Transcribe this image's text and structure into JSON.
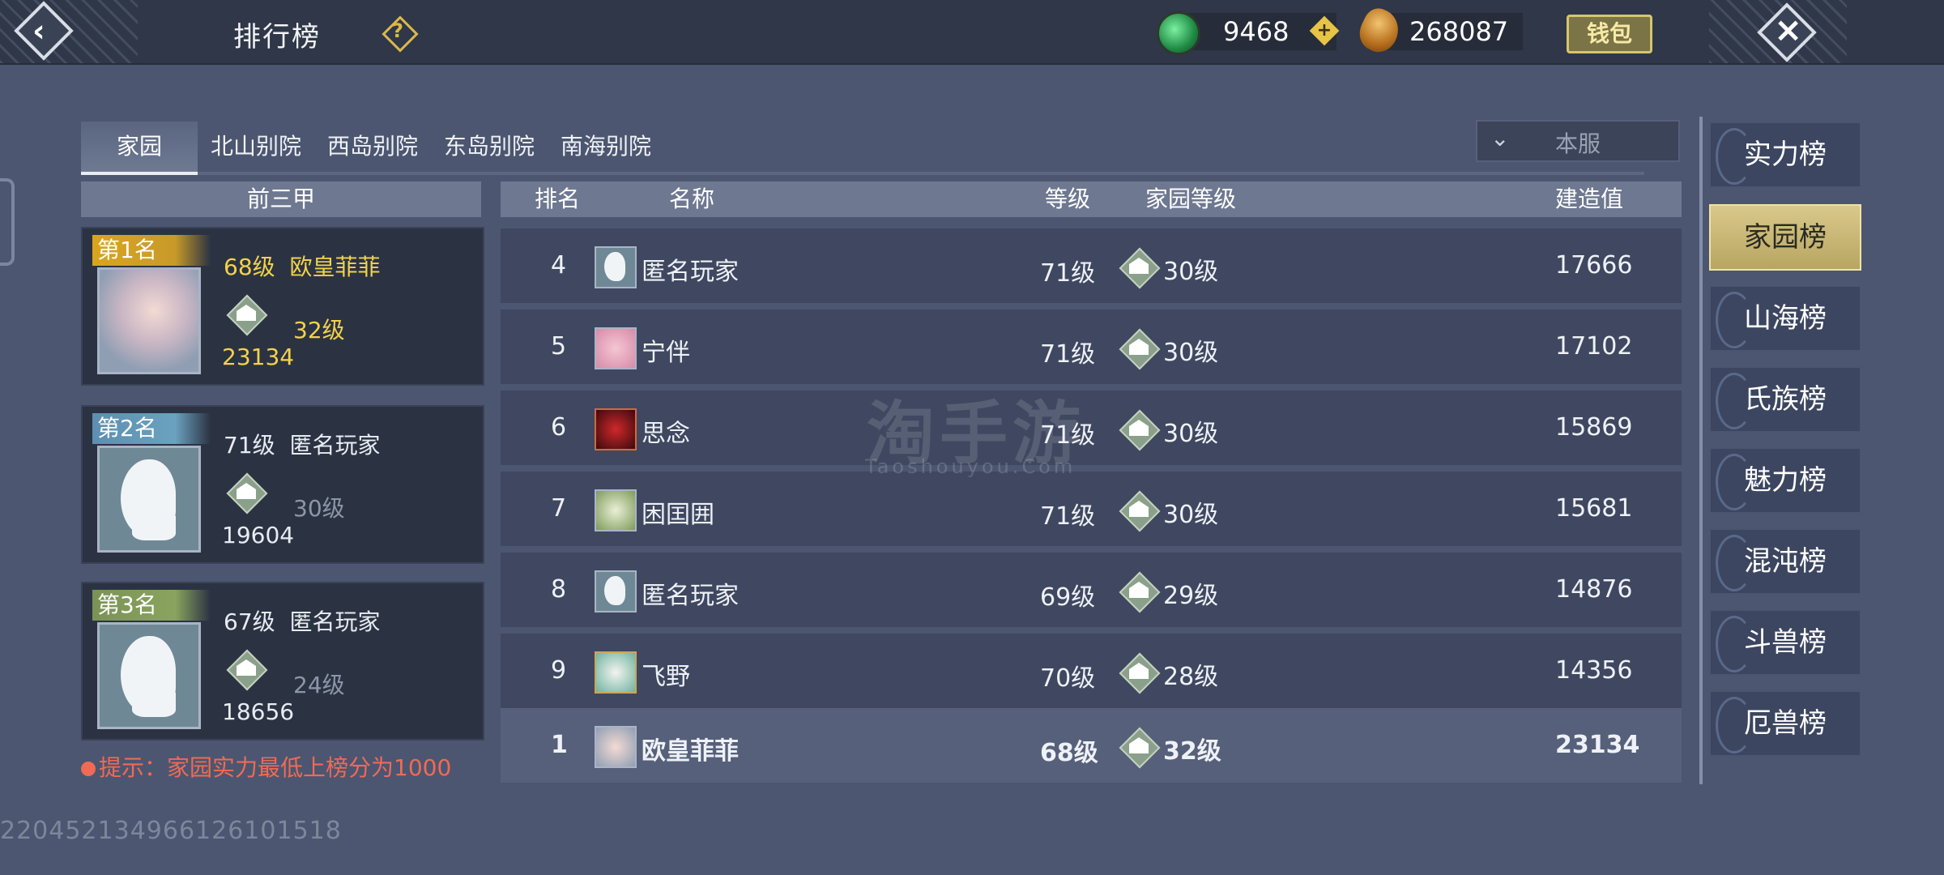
{
  "header": {
    "title": "排行榜",
    "help_icon": "question-icon",
    "jade": "9468",
    "coins": "268087",
    "wallet_label": "钱包"
  },
  "tabs": [
    {
      "label": "家园",
      "active": true
    },
    {
      "label": "北山别院",
      "active": false
    },
    {
      "label": "西岛别院",
      "active": false
    },
    {
      "label": "东岛别院",
      "active": false
    },
    {
      "label": "南海别院",
      "active": false
    }
  ],
  "server_filter": {
    "selected": "本服"
  },
  "top3": {
    "heading": "前三甲",
    "cards": [
      {
        "rank_label": "第1名",
        "level": "68级",
        "name": "欧皇菲菲",
        "home_level": "32级",
        "score": "23134"
      },
      {
        "rank_label": "第2名",
        "level": "71级",
        "name": "匿名玩家",
        "home_level": "30级",
        "score": "19604"
      },
      {
        "rank_label": "第3名",
        "level": "67级",
        "name": "匿名玩家",
        "home_level": "24级",
        "score": "18656"
      }
    ]
  },
  "tip": "提示：家园实力最低上榜分为1000",
  "user_id": "22045213496612610151​8",
  "list": {
    "headers": {
      "rank": "排名",
      "name": "名称",
      "level": "等级",
      "home_level": "家园等级",
      "score": "建造值"
    },
    "rows": [
      {
        "rank": "4",
        "name": "匿名玩家",
        "level": "71级",
        "home_level": "30级",
        "score": "17666"
      },
      {
        "rank": "5",
        "name": "宁伴",
        "level": "71级",
        "home_level": "30级",
        "score": "17102"
      },
      {
        "rank": "6",
        "name": "思念",
        "level": "71级",
        "home_level": "30级",
        "score": "15869"
      },
      {
        "rank": "7",
        "name": "困囯囲",
        "level": "71级",
        "home_level": "30级",
        "score": "15681"
      },
      {
        "rank": "8",
        "name": "匿名玩家",
        "level": "69级",
        "home_level": "29级",
        "score": "14876"
      },
      {
        "rank": "9",
        "name": "飞野",
        "level": "70级",
        "home_level": "28级",
        "score": "14356"
      }
    ],
    "my_row": {
      "rank": "1",
      "name": "欧皇菲菲",
      "level": "68级",
      "home_level": "32级",
      "score": "23134"
    }
  },
  "watermark": {
    "brand": "淘手游",
    "url": "Taoshouyou.Com"
  },
  "side_tabs": [
    {
      "label": "实力榜",
      "active": false
    },
    {
      "label": "家园榜",
      "active": true
    },
    {
      "label": "山海榜",
      "active": false
    },
    {
      "label": "氏族榜",
      "active": false
    },
    {
      "label": "魅力榜",
      "active": false
    },
    {
      "label": "混沌榜",
      "active": false
    },
    {
      "label": "斗兽榜",
      "active": false
    },
    {
      "label": "厄兽榜",
      "active": false
    }
  ]
}
